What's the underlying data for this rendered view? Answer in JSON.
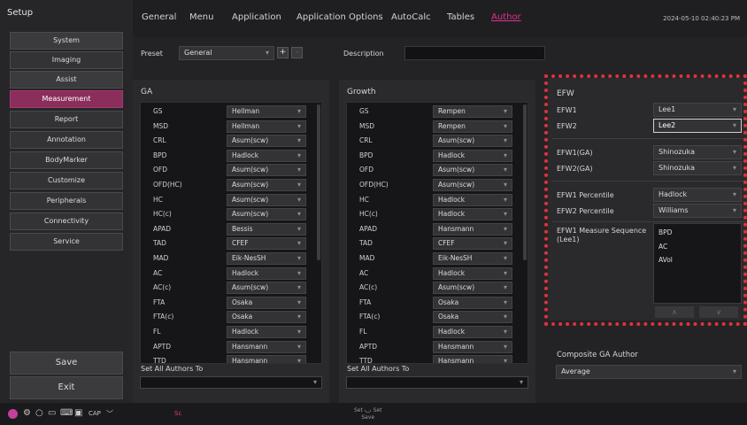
{
  "sidebar": {
    "title": "Setup",
    "items": [
      {
        "label": "System"
      },
      {
        "label": "Imaging"
      },
      {
        "label": "Assist"
      },
      {
        "label": "Measurement"
      },
      {
        "label": "Report"
      },
      {
        "label": "Annotation"
      },
      {
        "label": "BodyMarker"
      },
      {
        "label": "Customize"
      },
      {
        "label": "Peripherals"
      },
      {
        "label": "Connectivity"
      },
      {
        "label": "Service"
      }
    ],
    "save_label": "Save",
    "exit_label": "Exit"
  },
  "tabs": [
    "General",
    "Menu",
    "Application",
    "Application Options",
    "AutoCalc",
    "Tables",
    "Author"
  ],
  "active_tab": "Author",
  "datetime": "2024-05-10 02:40:23 PM",
  "preset": {
    "label": "Preset",
    "value": "General",
    "add": "+",
    "remove": "-"
  },
  "description": {
    "label": "Description",
    "value": ""
  },
  "ga": {
    "title": "GA",
    "rows": [
      {
        "label": "GS",
        "value": "Hellman"
      },
      {
        "label": "MSD",
        "value": "Hellman"
      },
      {
        "label": "CRL",
        "value": "Asum(scw)"
      },
      {
        "label": "BPD",
        "value": "Hadlock"
      },
      {
        "label": "OFD",
        "value": "Asum(scw)"
      },
      {
        "label": "OFD(HC)",
        "value": "Asum(scw)"
      },
      {
        "label": "HC",
        "value": "Asum(scw)"
      },
      {
        "label": "HC(c)",
        "value": "Asum(scw)"
      },
      {
        "label": "APAD",
        "value": "Bessis"
      },
      {
        "label": "TAD",
        "value": "CFEF"
      },
      {
        "label": "MAD",
        "value": "Eik-NesSH"
      },
      {
        "label": "AC",
        "value": "Hadlock"
      },
      {
        "label": "AC(c)",
        "value": "Asum(scw)"
      },
      {
        "label": "FTA",
        "value": "Osaka"
      },
      {
        "label": "FTA(c)",
        "value": "Osaka"
      },
      {
        "label": "FL",
        "value": "Hadlock"
      },
      {
        "label": "APTD",
        "value": "Hansmann"
      },
      {
        "label": "TTD",
        "value": "Hansmann"
      }
    ],
    "set_all_label": "Set All Authors To",
    "set_all_value": ""
  },
  "growth": {
    "title": "Growth",
    "rows": [
      {
        "label": "GS",
        "value": "Rempen"
      },
      {
        "label": "MSD",
        "value": "Rempen"
      },
      {
        "label": "CRL",
        "value": "Asum(scw)"
      },
      {
        "label": "BPD",
        "value": "Hadlock"
      },
      {
        "label": "OFD",
        "value": "Asum(scw)"
      },
      {
        "label": "OFD(HC)",
        "value": "Asum(scw)"
      },
      {
        "label": "HC",
        "value": "Hadlock"
      },
      {
        "label": "HC(c)",
        "value": "Hadlock"
      },
      {
        "label": "APAD",
        "value": "Hansmann"
      },
      {
        "label": "TAD",
        "value": "CFEF"
      },
      {
        "label": "MAD",
        "value": "Eik-NesSH"
      },
      {
        "label": "AC",
        "value": "Hadlock"
      },
      {
        "label": "AC(c)",
        "value": "Asum(scw)"
      },
      {
        "label": "FTA",
        "value": "Osaka"
      },
      {
        "label": "FTA(c)",
        "value": "Osaka"
      },
      {
        "label": "FL",
        "value": "Hadlock"
      },
      {
        "label": "APTD",
        "value": "Hansmann"
      },
      {
        "label": "TTD",
        "value": "Hansmann"
      }
    ],
    "set_all_label": "Set All Authors To",
    "set_all_value": ""
  },
  "efw": {
    "title": "EFW",
    "efw1_label": "EFW1",
    "efw1_value": "Lee1",
    "efw2_label": "EFW2",
    "efw2_value": "Lee2",
    "efw1ga_label": "EFW1(GA)",
    "efw1ga_value": "Shinozuka",
    "efw2ga_label": "EFW2(GA)",
    "efw2ga_value": "Shinozuka",
    "efw1pct_label": "EFW1 Percentile",
    "efw1pct_value": "Hadlock",
    "efw2pct_label": "EFW2 Percentile",
    "efw2pct_value": "Williams",
    "seq_label": "EFW1 Measure Sequence",
    "seq_sub": "(Lee1)",
    "sequence": [
      "BPD",
      "AC",
      "AVol"
    ],
    "up": "∧",
    "down": "∨"
  },
  "composite": {
    "label": "Composite GA Author",
    "value": "Average"
  },
  "status": {
    "sc": "Sc",
    "save_a": "Set",
    "save_b": "Set",
    "save_c": "Save",
    "cap": "CAP"
  }
}
